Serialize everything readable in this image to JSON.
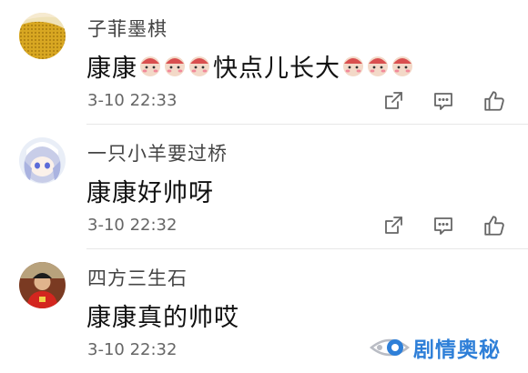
{
  "comments": [
    {
      "username": "子菲墨棋",
      "content_prefix": "康康",
      "emoji_before": [
        "blush-sticker",
        "blush-sticker",
        "blush-sticker"
      ],
      "content_middle": "快点儿长大",
      "emoji_after": [
        "blush-sticker",
        "blush-sticker",
        "blush-sticker"
      ],
      "timestamp": "3-10 22:33"
    },
    {
      "username": "一只小羊要过桥",
      "content": "康康好帅呀",
      "timestamp": "3-10 22:32"
    },
    {
      "username": "四方三生石",
      "content": "康康真的帅哎",
      "timestamp": "3-10 22:32"
    }
  ],
  "actions": [
    "share-icon",
    "reply-icon",
    "like-icon"
  ],
  "watermark": {
    "text": "剧情奥秘",
    "color": "#2e7fd8"
  },
  "colors": {
    "username": "#444444",
    "content": "#111111",
    "timestamp": "#666666",
    "divider": "#e8e8e8",
    "icon": "#666666"
  }
}
